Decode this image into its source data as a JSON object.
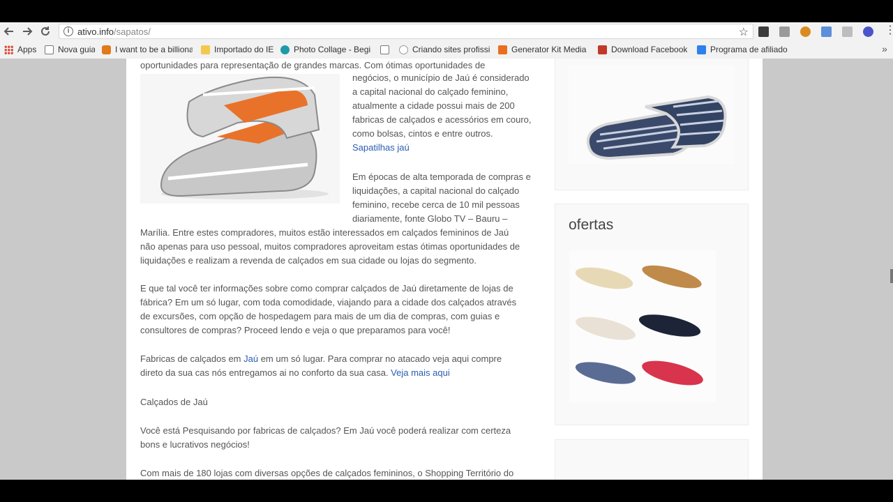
{
  "browser": {
    "url_host": "ativo.info",
    "url_path": "/sapatos/",
    "apps_label": "Apps",
    "bookmarks": [
      {
        "label": "Nova guia",
        "icon": "page-icon"
      },
      {
        "label": "I want to be a billiona",
        "icon": "shield-icon"
      },
      {
        "label": "Importado do IE",
        "icon": "folder-icon"
      },
      {
        "label": "Photo Collage - Begin",
        "icon": "c-logo-icon"
      },
      {
        "label": "",
        "icon": "page-icon"
      },
      {
        "label": "Criando sites profissic",
        "icon": "play-icon"
      },
      {
        "label": "Generator Kit Media -",
        "icon": "mf-logo-icon"
      },
      {
        "label": "Download Facebook,",
        "icon": "video-icon"
      },
      {
        "label": "Programa de afiliado:",
        "icon": "cart-icon"
      }
    ]
  },
  "article": {
    "p1_a": "oportunidades para representação de grandes marcas. Com ótimas oportunidades de",
    "p1_b": "negócios, o município de Jaú é considerado",
    "p1_c": "a capital nacional do calçado feminino,",
    "p1_d": "atualmente a cidade possui mais de 200",
    "p1_e": "fabricas de calçados e acessórios em couro,",
    "p1_f": "como bolsas, cintos e entre outros.",
    "p1_link": "Sapatilhas jaú",
    "p2_a": "Em épocas de alta temporada de compras e",
    "p2_b": "liquidações, a capital nacional do calçado",
    "p2_c": "feminino, recebe cerca de 10 mil pessoas",
    "p2_d": "diariamente, fonte Globo TV – Bauru –",
    "p2_e": "Marília. Entre estes compradores, muitos estão interessados em calçados femininos de Jaú",
    "p2_f": "não apenas para uso pessoal, muitos compradores aproveitam estas ótimas oportunidades de",
    "p2_g": "liquidações e realizam a revenda de calçados em sua cidade ou lojas do segmento.",
    "p3_a": "E que tal você ter informações sobre como comprar calçados de Jaú diretamente de lojas de",
    "p3_b": "fábrica? Em um só lugar, com toda comodidade, viajando para a cidade dos calçados através",
    "p3_c": "de excursões, com opção de hospedagem para mais de um dia de compras, com guias e",
    "p3_d": "consultores de compras? Proceed lendo e veja o que preparamos para você!",
    "p4_pre": "Fabricas de calçados em ",
    "p4_link1": "Jaú",
    "p4_mid": " em um só lugar. Para comprar no atacado veja aqui compre",
    "p4_b": "direto da sua cas nós entregamos ai no conforto da sua casa. ",
    "p4_link2": "Veja mais aqui",
    "p5": "Calçados de Jaú",
    "p6_a": "Você está Pesquisando por fabricas de calçados? Em Jaú você poderá realizar com certeza",
    "p6_b": "bons e lucrativos negócios!",
    "p7": "Com mais de 180 lojas com diversas opções de calçados femininos, o Shopping Território do"
  },
  "sidebar": {
    "ofertas_title": "ofertas"
  },
  "colors": {
    "link": "#2a5db0",
    "text": "#555555",
    "page_bg": "#c9c9c9"
  }
}
